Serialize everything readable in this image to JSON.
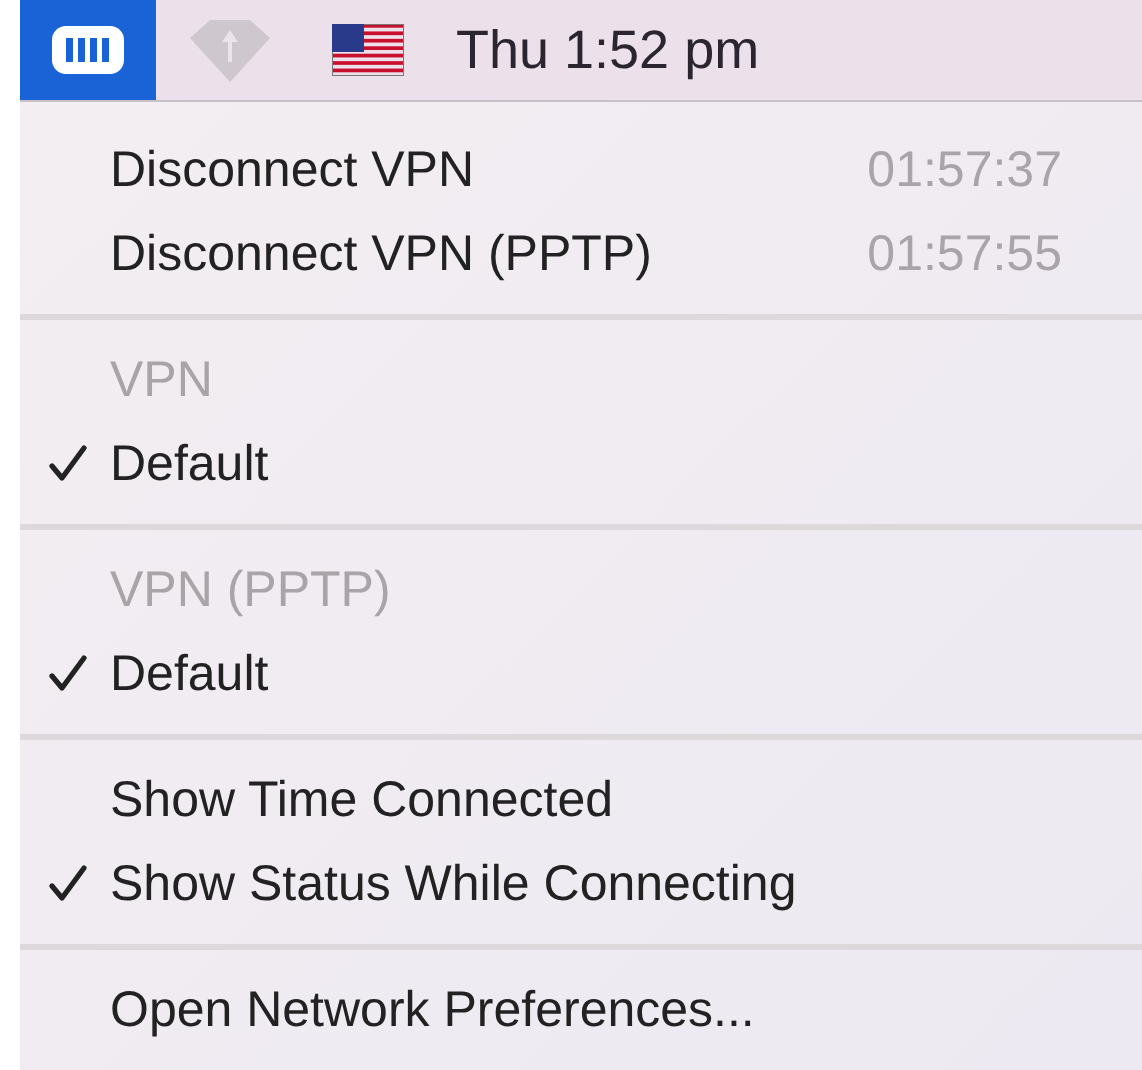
{
  "menubar": {
    "icons": [
      {
        "kind": "vpn",
        "selected": true
      },
      {
        "kind": "wifi",
        "selected": false,
        "disabled": true
      },
      {
        "kind": "flag",
        "selected": false
      }
    ],
    "clock": "Thu 1:52 pm"
  },
  "menu": {
    "sections": [
      {
        "items": [
          {
            "kind": "action",
            "label": "Disconnect VPN",
            "time": "01:57:37"
          },
          {
            "kind": "action",
            "label": "Disconnect VPN (PPTP)",
            "time": "01:57:55"
          }
        ]
      },
      {
        "items": [
          {
            "kind": "header",
            "label": "VPN"
          },
          {
            "kind": "toggle",
            "label": "Default",
            "checked": true
          }
        ]
      },
      {
        "items": [
          {
            "kind": "header",
            "label": "VPN (PPTP)"
          },
          {
            "kind": "toggle",
            "label": "Default",
            "checked": true
          }
        ]
      },
      {
        "items": [
          {
            "kind": "toggle",
            "label": "Show Time Connected",
            "checked": false
          },
          {
            "kind": "toggle",
            "label": "Show Status While Connecting",
            "checked": true
          }
        ]
      },
      {
        "items": [
          {
            "kind": "action",
            "label": "Open Network Preferences..."
          }
        ]
      }
    ]
  }
}
